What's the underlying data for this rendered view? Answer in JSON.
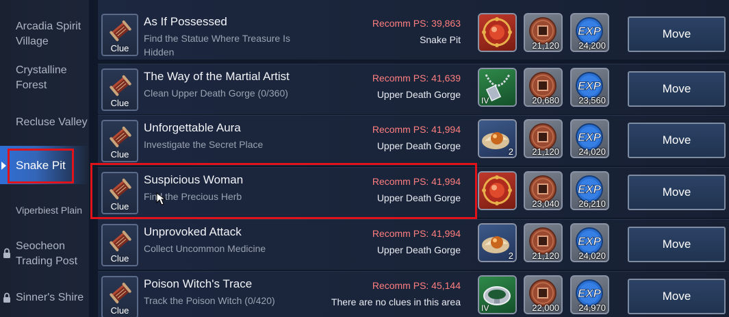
{
  "sidebar": {
    "items": [
      {
        "label": "Arcadia Spirit Village",
        "locked": false
      },
      {
        "label": "Crystalline Forest",
        "locked": false
      },
      {
        "label": "Recluse Valley",
        "locked": false
      },
      {
        "label": "Snake Pit",
        "locked": false,
        "active": true
      },
      {
        "label": "Viperbiest Plain",
        "locked": false
      },
      {
        "label": "Seocheon Trading Post",
        "locked": true
      },
      {
        "label": "Sinner's Shire",
        "locked": true
      }
    ]
  },
  "quests": [
    {
      "clue_label": "Clue",
      "title": "As If Possessed",
      "desc": "Find the Statue Where Treasure Is Hidden",
      "recomm": "Recomm PS: 39,863",
      "area": "Snake Pit",
      "reward_item": "red-orb-icon",
      "gold": "21,120",
      "exp": "24,200",
      "move": "Move"
    },
    {
      "clue_label": "Clue",
      "title": "The Way of the Martial Artist",
      "desc": "Clean Upper Death Gorge (0/360)",
      "recomm": "Recomm PS: 41,639",
      "area": "Upper Death Gorge",
      "reward_item": "necklace-icon",
      "item_tier": "IV",
      "gold": "20,680",
      "exp": "23,560",
      "move": "Move"
    },
    {
      "clue_label": "Clue",
      "title": "Unforgettable Aura",
      "desc": "Investigate the Secret Place",
      "recomm": "Recomm PS: 41,994",
      "area": "Upper Death Gorge",
      "reward_item": "herb-icon",
      "item_count": "2",
      "gold": "21,120",
      "exp": "24,020",
      "move": "Move"
    },
    {
      "clue_label": "Clue",
      "title": "Suspicious Woman",
      "desc": "Find the Precious Herb",
      "recomm": "Recomm PS: 41,994",
      "area": "Upper Death Gorge",
      "reward_item": "red-orb-icon",
      "gold": "23,040",
      "exp": "26,210",
      "move": "Move"
    },
    {
      "clue_label": "Clue",
      "title": "Unprovoked Attack",
      "desc": "Collect Uncommon Medicine",
      "recomm": "Recomm PS: 41,994",
      "area": "Upper Death Gorge",
      "reward_item": "herb-icon",
      "item_count": "2",
      "gold": "21,120",
      "exp": "24,020",
      "move": "Move"
    },
    {
      "clue_label": "Clue",
      "title": "Poison Witch's Trace",
      "desc": "Track the Poison Witch (0/420)",
      "recomm": "Recomm PS: 45,144",
      "area": "There are no clues in this area",
      "reward_item": "bracelet-icon",
      "item_tier": "IV",
      "gold": "22,000",
      "exp": "24,970",
      "move": "Move"
    }
  ],
  "colors": {
    "highlight": "#e0131b",
    "recomm": "#ff7f7f",
    "active_tab": "#2f6fd6"
  }
}
